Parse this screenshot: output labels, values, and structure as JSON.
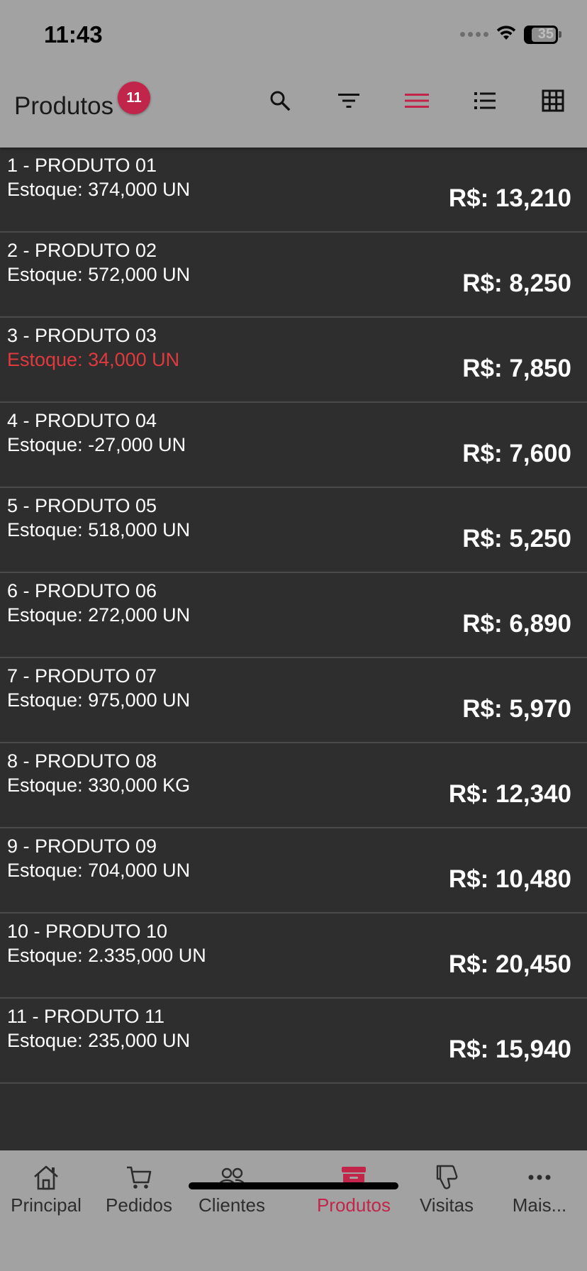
{
  "status_bar": {
    "time": "11:43",
    "battery": "35"
  },
  "app_bar": {
    "title": "Produtos",
    "badge_count": "11",
    "icons": [
      "search-icon",
      "filter-icon",
      "view-compact-icon",
      "view-list-icon",
      "view-grid-icon"
    ],
    "active_color": "#c2254a"
  },
  "products": [
    {
      "title": "1 - PRODUTO 01",
      "stock": "Estoque: 374,000 UN",
      "price": "R$: 13,210",
      "low_stock": false
    },
    {
      "title": "2 - PRODUTO 02",
      "stock": "Estoque: 572,000 UN",
      "price": "R$: 8,250",
      "low_stock": false
    },
    {
      "title": "3 - PRODUTO 03",
      "stock": "Estoque: 34,000 UN",
      "price": "R$: 7,850",
      "low_stock": true
    },
    {
      "title": "4 - PRODUTO 04",
      "stock": "Estoque: -27,000 UN",
      "price": "R$: 7,600",
      "low_stock": false
    },
    {
      "title": "5 - PRODUTO 05",
      "stock": "Estoque: 518,000 UN",
      "price": "R$: 5,250",
      "low_stock": false
    },
    {
      "title": "6 - PRODUTO 06",
      "stock": "Estoque: 272,000 UN",
      "price": "R$: 6,890",
      "low_stock": false
    },
    {
      "title": "7 - PRODUTO 07",
      "stock": "Estoque: 975,000 UN",
      "price": "R$: 5,970",
      "low_stock": false
    },
    {
      "title": "8 - PRODUTO 08",
      "stock": "Estoque: 330,000 KG",
      "price": "R$: 12,340",
      "low_stock": false
    },
    {
      "title": "9 - PRODUTO 09",
      "stock": "Estoque: 704,000 UN",
      "price": "R$: 10,480",
      "low_stock": false
    },
    {
      "title": "10 - PRODUTO 10",
      "stock": "Estoque: 2.335,000 UN",
      "price": "R$: 20,450",
      "low_stock": false
    },
    {
      "title": "11 - PRODUTO 11",
      "stock": "Estoque: 235,000 UN",
      "price": "R$: 15,940",
      "low_stock": false
    }
  ],
  "bottom_nav": {
    "items": [
      {
        "label": "Principal",
        "icon": "home-icon"
      },
      {
        "label": "Pedidos",
        "icon": "cart-icon"
      },
      {
        "label": "Clientes",
        "icon": "users-icon"
      },
      {
        "label": "Produtos",
        "icon": "archive-box-icon"
      },
      {
        "label": "Visitas",
        "icon": "thumbs-down-icon"
      },
      {
        "label": "Mais...",
        "icon": "more-dots-icon"
      }
    ],
    "active_label": "Produtos"
  }
}
